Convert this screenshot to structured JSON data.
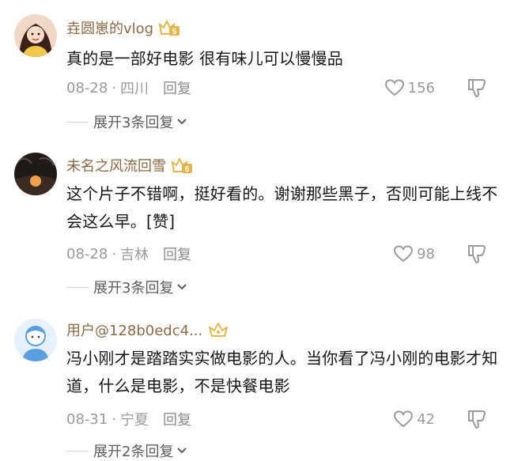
{
  "comments": [
    {
      "username": "垚圆崽的vlog",
      "badge_level": "5",
      "content": "真的是一部好电影 很有味儿可以慢慢品",
      "date": "08-28",
      "separator": "·",
      "location": "四川",
      "reply_label": "回复",
      "likes": "156",
      "expand_label": "展开3条回复"
    },
    {
      "username": "未名之风流回雪",
      "badge_level": "6",
      "content": "这个片子不错啊，挺好看的。谢谢那些黑子，否则可能上线不会这么早。[赞]",
      "date": "08-28",
      "separator": "·",
      "location": "吉林",
      "reply_label": "回复",
      "likes": "98",
      "expand_label": "展开3条回复"
    },
    {
      "username": "用户@128b0edc4...",
      "badge_level": "",
      "content": "冯小刚才是踏踏实实做电影的人。当你看了冯小刚的电影才知道，什么是电影，不是快餐电影",
      "date": "08-31",
      "separator": "·",
      "location": "宁夏",
      "reply_label": "回复",
      "likes": "42",
      "expand_label": "展开2条回复"
    }
  ],
  "colors": {
    "username": "#8a6a46",
    "badge": "#e2b64a",
    "meta": "#9a9a9a",
    "text": "#161616"
  },
  "icons": [
    "avatar",
    "level-badge-icon",
    "heart-icon",
    "dislike-icon",
    "chevron-down-icon"
  ]
}
